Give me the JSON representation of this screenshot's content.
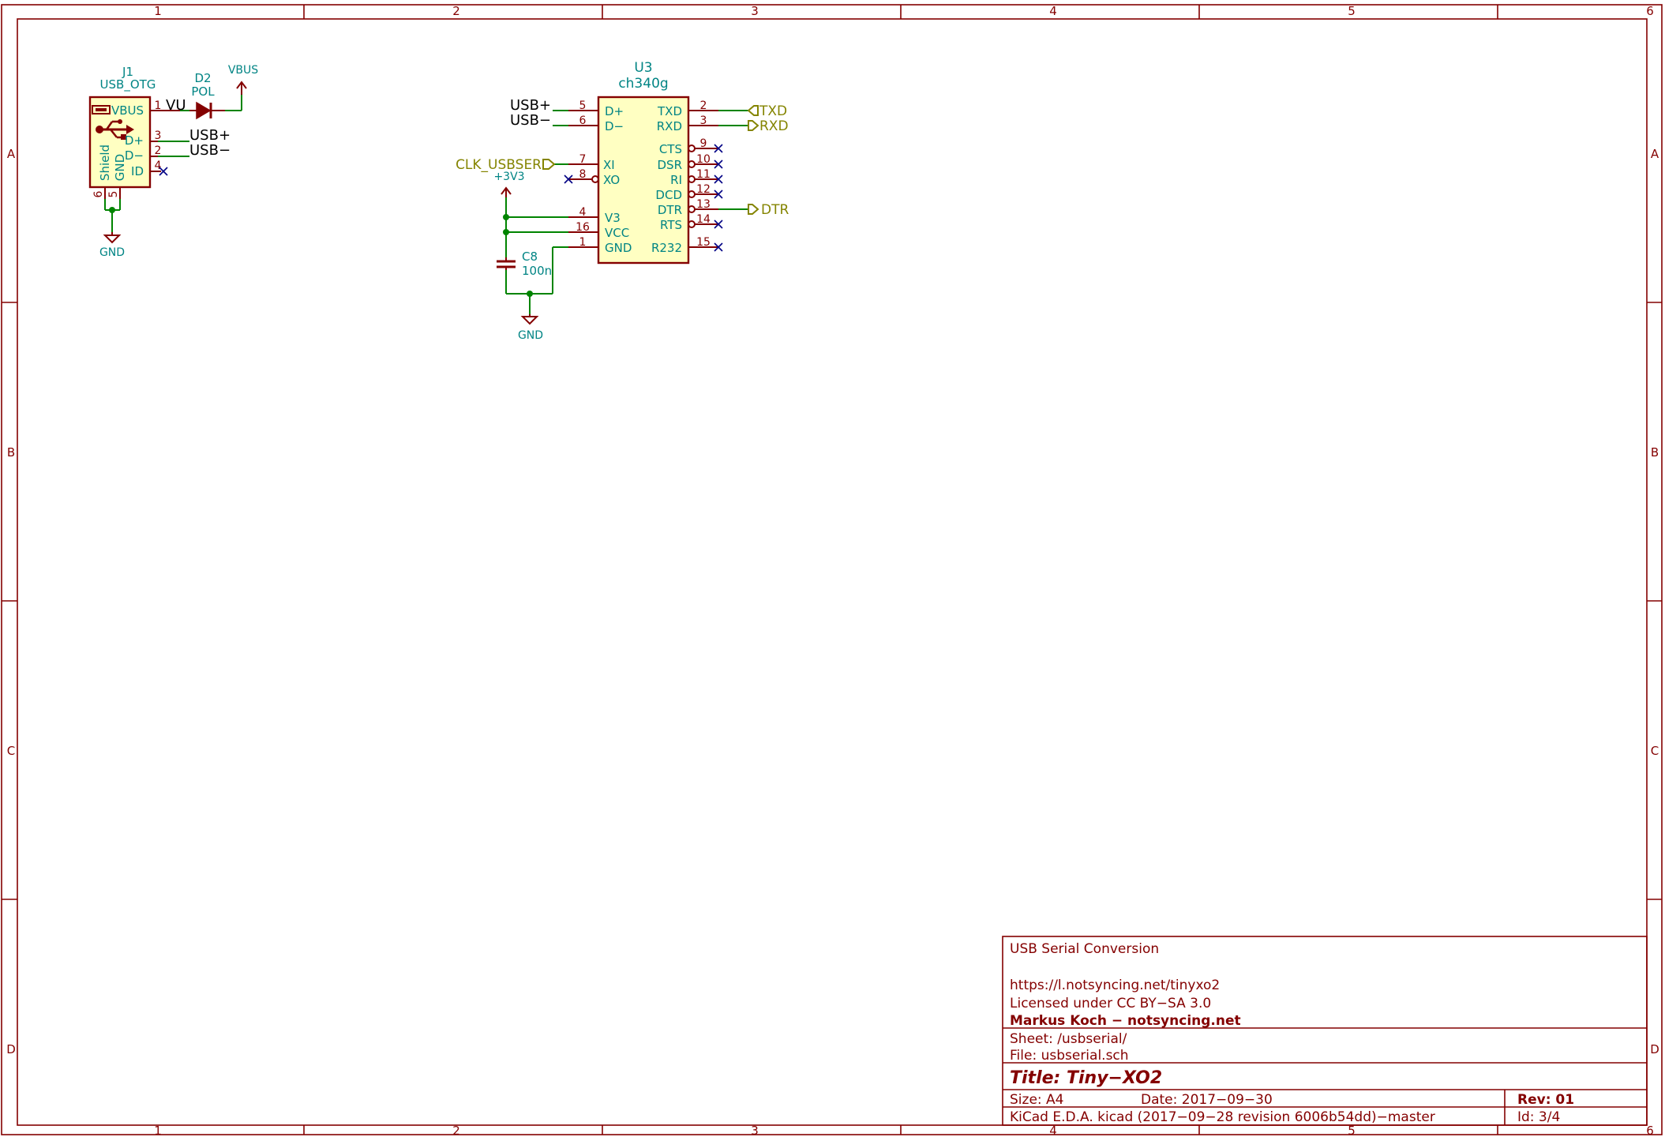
{
  "frame": {
    "columns": [
      "1",
      "2",
      "3",
      "4",
      "5",
      "6"
    ],
    "rows": [
      "A",
      "B",
      "C",
      "D"
    ]
  },
  "components": {
    "j1": {
      "ref": "J1",
      "value": "USB_OTG",
      "pins": [
        {
          "num": "1",
          "name": "VBUS"
        },
        {
          "num": "3",
          "name": "D+"
        },
        {
          "num": "2",
          "name": "D−"
        },
        {
          "num": "4",
          "name": "ID"
        },
        {
          "num": "6",
          "name": "Shield"
        },
        {
          "num": "5",
          "name": "GND"
        }
      ]
    },
    "d2": {
      "ref": "D2",
      "value": "POL"
    },
    "u3": {
      "ref": "U3",
      "value": "ch340g",
      "left_pins": [
        {
          "num": "5",
          "name": "D+"
        },
        {
          "num": "6",
          "name": "D−"
        },
        {
          "num": "7",
          "name": "XI"
        },
        {
          "num": "8",
          "name": "XO"
        },
        {
          "num": "4",
          "name": "V3"
        },
        {
          "num": "16",
          "name": "VCC"
        },
        {
          "num": "1",
          "name": "GND"
        }
      ],
      "right_pins": [
        {
          "num": "2",
          "name": "TXD"
        },
        {
          "num": "3",
          "name": "RXD"
        },
        {
          "num": "9",
          "name": "CTS"
        },
        {
          "num": "10",
          "name": "DSR"
        },
        {
          "num": "11",
          "name": "RI"
        },
        {
          "num": "12",
          "name": "DCD"
        },
        {
          "num": "13",
          "name": "DTR"
        },
        {
          "num": "14",
          "name": "RTS"
        },
        {
          "num": "15",
          "name": "R232"
        }
      ]
    },
    "c8": {
      "ref": "C8",
      "value": "100n"
    }
  },
  "power": {
    "vbus": "VBUS",
    "v3v3": "+3V3",
    "gnd1": "GND",
    "gnd2": "GND"
  },
  "nets": {
    "vu": "VU",
    "usb_plus_j1": "USB+",
    "usb_minus_j1": "USB−",
    "usb_plus_u3": "USB+",
    "usb_minus_u3": "USB−"
  },
  "global_labels": {
    "clk": "CLK_USBSER",
    "txd": "TXD",
    "rxd": "RXD",
    "dtr": "DTR"
  },
  "title_block": {
    "comment1": "USB Serial Conversion",
    "comment2": "https://l.notsyncing.net/tinyxo2",
    "comment3": "Licensed under CC BY−SA 3.0",
    "company": "Markus Koch − notsyncing.net",
    "sheet": "Sheet: /usbserial/",
    "file": "File: usbserial.sch",
    "title": "Title: Tiny−XO2",
    "size": "Size: A4",
    "date": "Date: 2017−09−30",
    "rev": "Rev: 01",
    "tool": "KiCad E.D.A.  kicad (2017−09−28 revision 6006b54dd)−master",
    "id": "Id: 3/4"
  },
  "colors": {
    "frame": "#840000",
    "wire": "#008400",
    "body_fill": "#ffffc2",
    "pin_name": "#008484",
    "global_label": "#848400",
    "no_connect": "#000084"
  }
}
